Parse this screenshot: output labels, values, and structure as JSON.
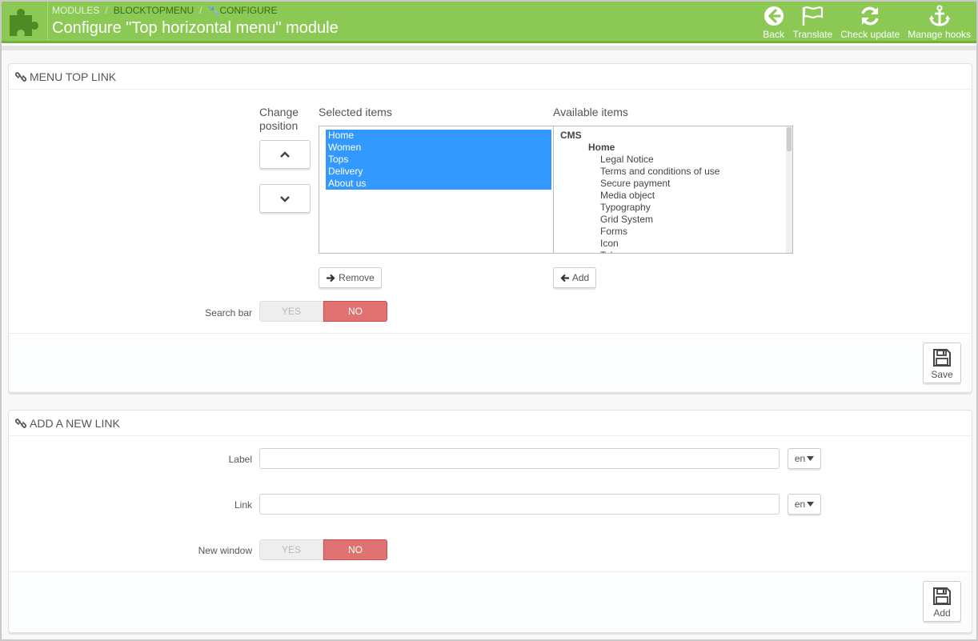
{
  "header": {
    "breadcrumb": [
      "MODULES",
      "BLOCKTOPMENU",
      "CONFIGURE"
    ],
    "title": "Configure \"Top horizontal menu\" module",
    "toolbar": [
      {
        "label": "Back",
        "icon": "back-circle-arrow-icon"
      },
      {
        "label": "Translate",
        "icon": "flag-icon"
      },
      {
        "label": "Check update",
        "icon": "refresh-icon"
      },
      {
        "label": "Manage hooks",
        "icon": "anchor-icon"
      }
    ],
    "colors": {
      "bar": "#8bc954",
      "bar_border": "#72b13c"
    }
  },
  "menu_panel": {
    "heading": "MENU TOP LINK",
    "change_position_label": "Change position",
    "selected_label": "Selected items",
    "available_label": "Available items",
    "selected_items": [
      "Home",
      "Women",
      "Tops",
      "Delivery",
      "About us"
    ],
    "available_items": [
      {
        "text": "CMS",
        "level": 0
      },
      {
        "text": "Home",
        "level": 1
      },
      {
        "text": "Legal Notice",
        "level": 2
      },
      {
        "text": "Terms and conditions of use",
        "level": 2
      },
      {
        "text": "Secure payment",
        "level": 2
      },
      {
        "text": "Media object",
        "level": 2
      },
      {
        "text": "Typography",
        "level": 2
      },
      {
        "text": "Grid System",
        "level": 2
      },
      {
        "text": "Forms",
        "level": 2
      },
      {
        "text": "Icon",
        "level": 2
      },
      {
        "text": "Tabs",
        "level": 2
      }
    ],
    "remove_label": "Remove",
    "add_label": "Add",
    "search_bar_label": "Search bar",
    "search_bar_yes": "YES",
    "search_bar_no": "NO",
    "search_bar_value": "NO",
    "save_label": "Save"
  },
  "new_link_panel": {
    "heading": "ADD A NEW LINK",
    "label_field": {
      "label": "Label",
      "value": "",
      "lang": "en"
    },
    "link_field": {
      "label": "Link",
      "value": "",
      "lang": "en"
    },
    "new_window_label": "New window",
    "new_window_yes": "YES",
    "new_window_no": "NO",
    "new_window_value": "NO",
    "add_label": "Add"
  }
}
